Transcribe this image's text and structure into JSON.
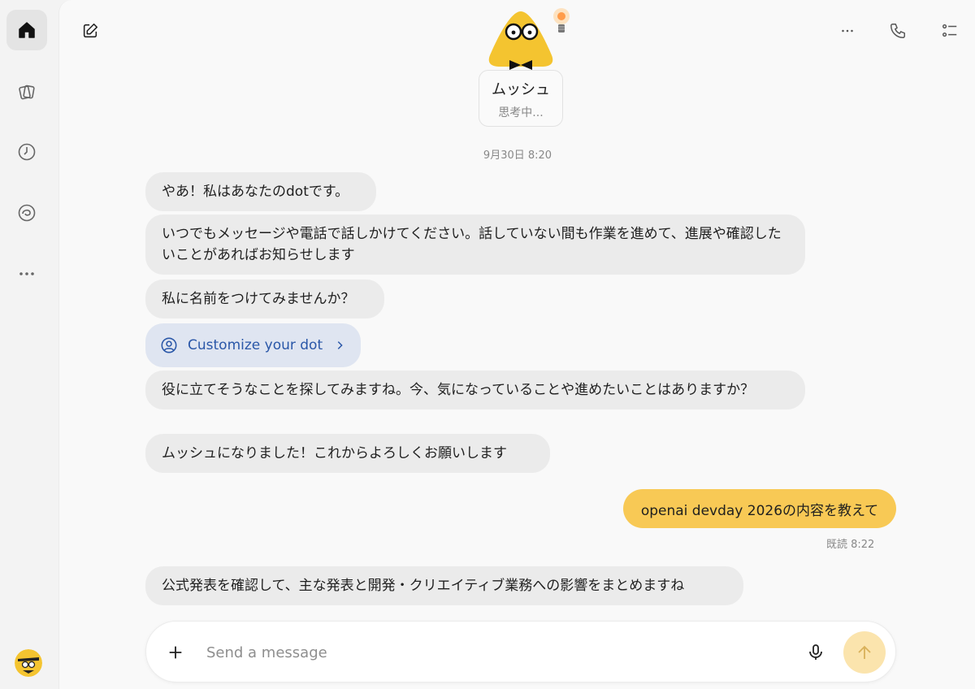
{
  "sidebar": {
    "items": [
      {
        "name": "home-icon",
        "active": true
      },
      {
        "name": "cards-icon",
        "active": false
      },
      {
        "name": "clock-icon",
        "active": false
      },
      {
        "name": "swirl-icon",
        "active": false
      },
      {
        "name": "more-horizontal-icon",
        "active": false
      }
    ]
  },
  "header": {
    "persona_name": "ムッシュ",
    "persona_status": "思考中..."
  },
  "chat": {
    "date": "9月30日 8:20",
    "assistant_messages": [
      "やあ！私はあなたのdotです。",
      "いつでもメッセージや電話で話しかけてください。話していない間も作業を進めて、進展や確認したいことがあればお知らせします",
      "私に名前をつけてみませんか？",
      "役に立てそうなことを探してみますね。今、気になっていることや進めたいことはありますか？",
      "ムッシュになりました！これからよろしくお願いします",
      "公式発表を確認して、主な発表と開発・クリエイティブ業務への影響をまとめますね"
    ],
    "customize_chip": "Customize your dot",
    "user_message": "openai devday 2026の内容を教えて",
    "read_receipt": "既読 8:22"
  },
  "composer": {
    "placeholder": "Send a message",
    "value": ""
  },
  "colors": {
    "accent": "#f8c955",
    "send_button": "#fbe4ad",
    "chip_bg": "#dfe5f1",
    "chip_text": "#2a57a8",
    "bubble_bg": "#ebebeb"
  }
}
